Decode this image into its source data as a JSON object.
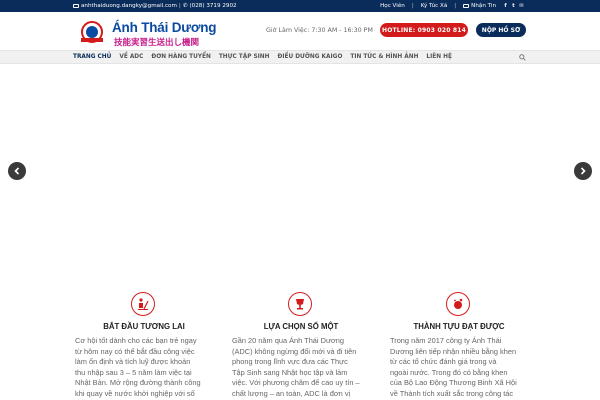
{
  "topbar": {
    "email": "anhthaiduong.dangky@gmail.com",
    "phone": "(028) 3719 2902",
    "links": [
      "Học Viên",
      "Ký Túc Xá",
      "Nhận Tin"
    ],
    "social_icons": [
      "facebook-icon",
      "twitter-icon",
      "email-icon"
    ]
  },
  "header": {
    "brand": "Ánh Thái Dương",
    "brand_sub": "技能実習生送出し機関",
    "hours": "Giờ Làm Việc: 7:30 AM - 16:30 PM",
    "hotline": "HOTLINE: 0903 020 814",
    "apply": "NỘP HỒ SƠ"
  },
  "nav": {
    "items": [
      "TRANG CHỦ",
      "VỀ ADC",
      "ĐƠN HÀNG TUYỂN",
      "THỰC TẬP SINH",
      "ĐIỀU DƯỠNG KAIGO",
      "TIN TỨC & HÌNH ẢNH",
      "LIÊN HỆ"
    ]
  },
  "features": [
    {
      "title": "BẮT ĐẦU TƯƠNG LAI",
      "lines": [
        "Cơ hội tốt dành cho các bạn trẻ ngay",
        "từ hôm nay có thể bắt đầu công việc",
        "làm ổn định và tích luỹ được khoản",
        "thu nhập sau 3 – 5 năm làm việc tại",
        "Nhật Bản. Mở rộng đường thành công",
        "khi quay về nước khởi nghiệp với số"
      ]
    },
    {
      "title": "LỰA CHỌN SỐ MỘT",
      "lines": [
        "Gần 20 năm qua Ánh Thái Dương",
        "(ADC) không ngừng đổi mới và đi tiên",
        "phong trong lĩnh vực đưa các Thực",
        "Tập Sinh sang Nhật học tập và làm",
        "việc. Với phương châm để cao uy tín –",
        "chất lượng – an toàn, ADC là đơn vị"
      ]
    },
    {
      "title": "THÀNH TỰU ĐẠT ĐƯỢC",
      "lines": [
        "Trong năm 2017 công ty Ánh Thái",
        "Dương liên tiếp nhận nhiều bằng khen",
        "từ các tổ chức đánh giá trong và",
        "ngoài nước. Trong đó có bằng khen",
        "của Bộ Lao Động Thương Binh Xã Hội",
        "về Thành tích xuất sắc trong công tác"
      ]
    }
  ],
  "colors": {
    "navy": "#0a2c5a",
    "red": "#d41b1b",
    "brand_blue": "#0a4aa0",
    "brand_pink": "#c8208c"
  }
}
